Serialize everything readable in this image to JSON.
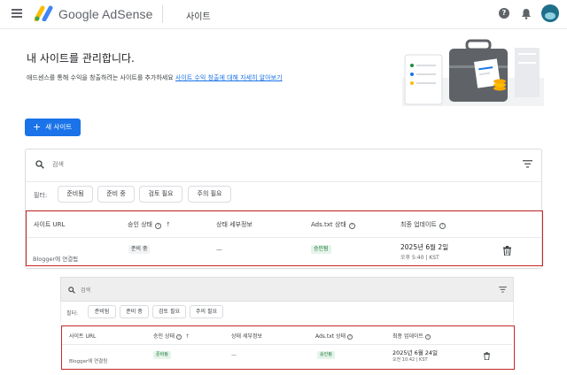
{
  "header": {
    "app_title": "Google AdSense",
    "section_title": "사이트",
    "help_icon_glyph": "?",
    "icons": [
      "menu-icon",
      "adsense-logo-icon",
      "help-icon",
      "bell-icon",
      "avatar"
    ]
  },
  "page": {
    "heading": "내 사이트를 관리합니다.",
    "description": "애드센스를 통해 수익을 창출하려는 사이트를 추가하세요",
    "learn_more_link": "사이트 수익 창출에 대해 자세히 알아보기",
    "new_site_button": "새 사이트",
    "new_site_plus": "+"
  },
  "main_card": {
    "search_placeholder": "검색",
    "filter_label": "필터:",
    "filter_chips": [
      "준비됨",
      "준비 중",
      "검토 필요",
      "주의 필요"
    ],
    "columns": [
      "사이트 URL",
      "승인 상태",
      "상태 세부정보",
      "Ads.txt 상태",
      "최종 업데이트"
    ],
    "row": {
      "site_sub": "Blogger에 연결됨",
      "approval_status": "준비 중",
      "status_detail": "—",
      "ads_txt": "승인됨",
      "updated_date": "2025년 6월 2일",
      "updated_time": "오후 5:40 | KST"
    }
  },
  "second_card": {
    "search_placeholder": "검색",
    "filter_label": "필터:",
    "filter_chips": [
      "준비됨",
      "준비 중",
      "검토 필요",
      "주의 필요"
    ],
    "columns": [
      "사이트 URL",
      "승인 상태",
      "상태 세부정보",
      "Ads.txt 상태",
      "최종 업데이트"
    ],
    "row": {
      "site_sub": "Blogger에 연결됨",
      "approval_status": "준비됨",
      "status_detail": "—",
      "ads_txt": "승인됨",
      "updated_date": "2025년 6월 24일",
      "updated_time": "오전 10:42 | KST"
    }
  },
  "colors": {
    "accent": "#1a73e8",
    "highlight_box": "#c62828",
    "badge_green_bg": "#e6f4ea",
    "badge_green_text": "#137333"
  }
}
